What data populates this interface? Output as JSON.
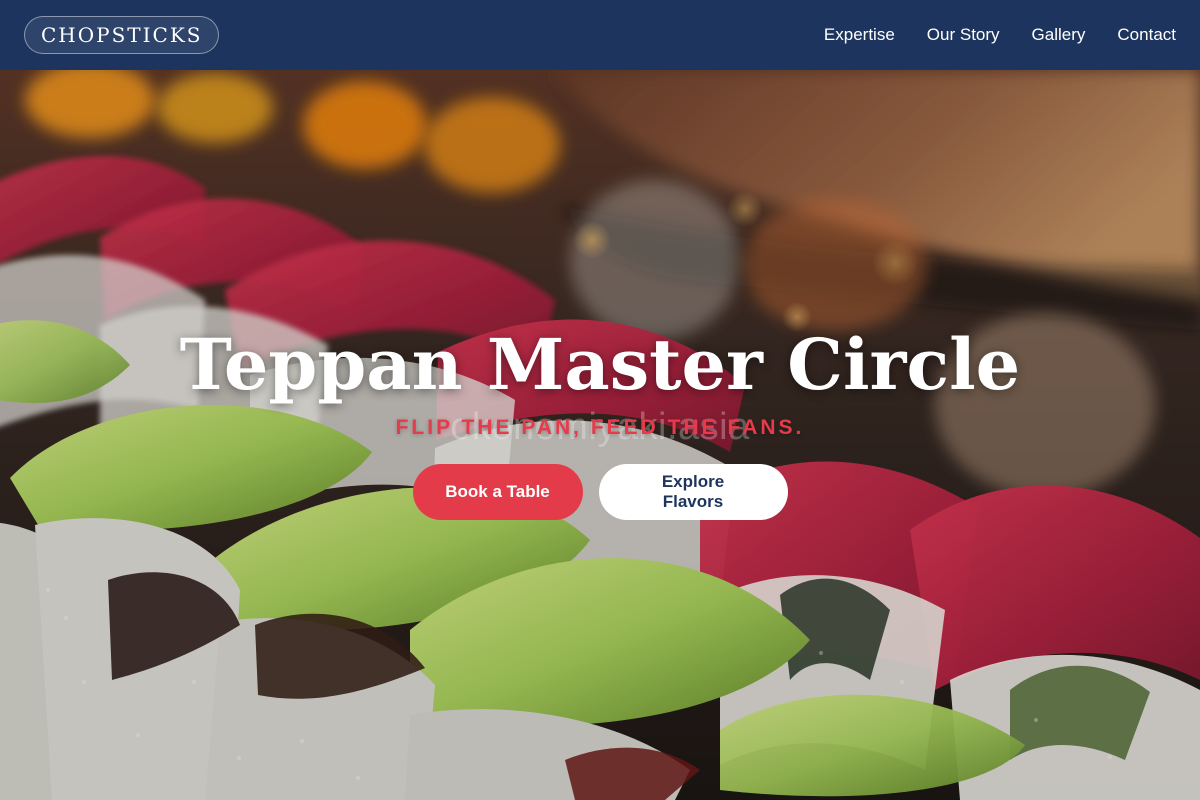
{
  "brand": {
    "name": "CHOPSTICKS"
  },
  "nav": {
    "items": [
      {
        "label": "Expertise"
      },
      {
        "label": "Our Story"
      },
      {
        "label": "Gallery"
      },
      {
        "label": "Contact"
      }
    ]
  },
  "hero": {
    "title": "Teppan Master Circle",
    "tagline": "FLIP THE PAN, FEED THE FANS.",
    "watermark": "okonomiyaki.asia",
    "buttons": {
      "primary_label": "Book a Table",
      "secondary_label": "Explore Flavors"
    }
  },
  "colors": {
    "nav_bg": "#1d355e",
    "accent_red": "#e43b4a",
    "button_text_navy": "#1d355e",
    "white": "#ffffff"
  }
}
